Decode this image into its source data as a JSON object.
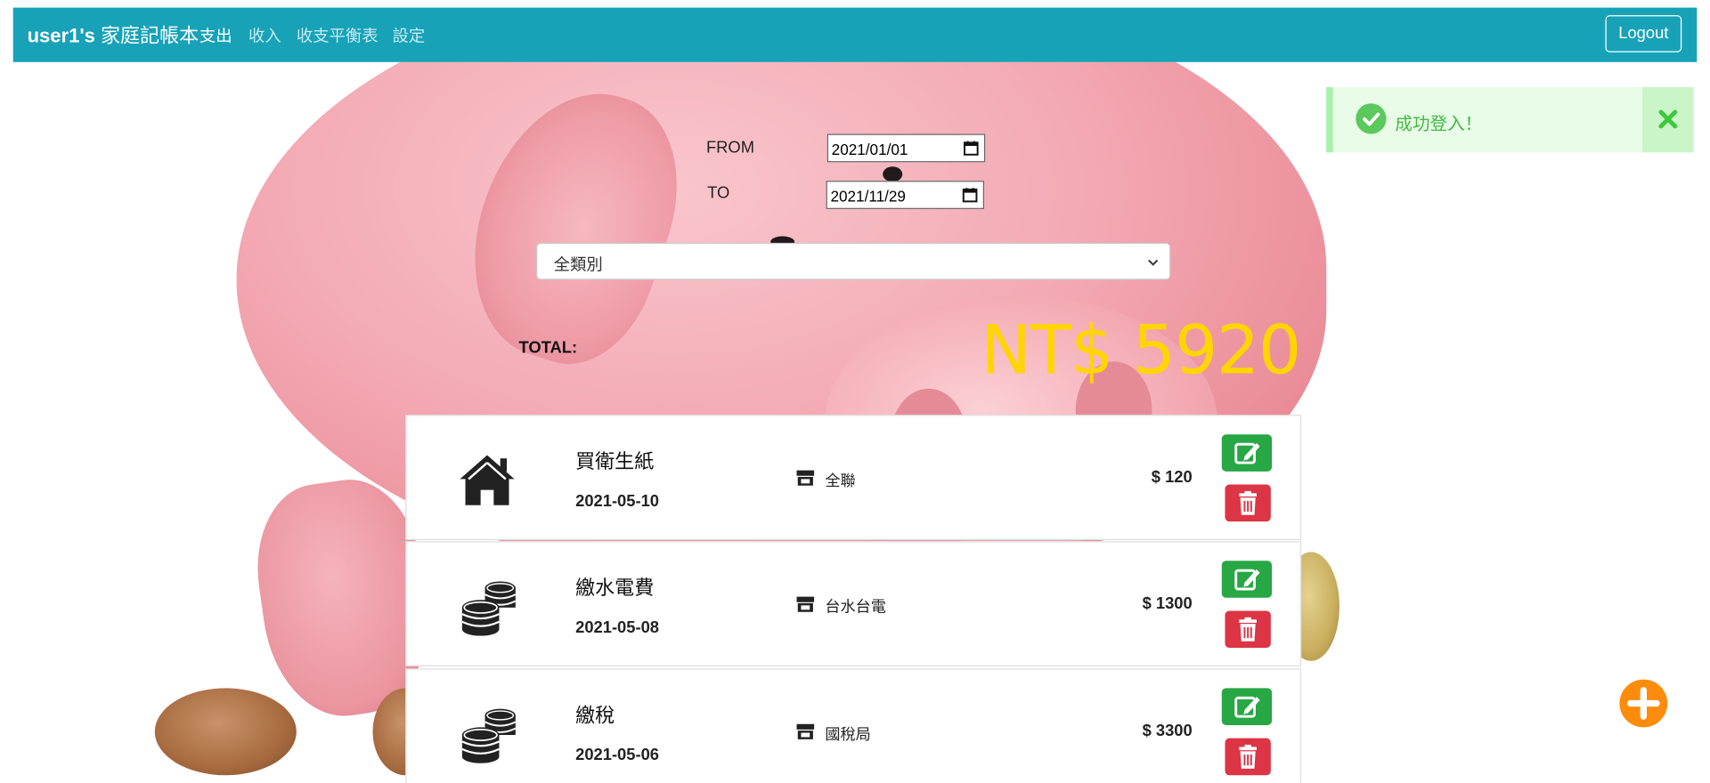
{
  "navbar": {
    "brand_user": "user1's",
    "brand_title": "家庭記帳本",
    "links": [
      "支出",
      "收入",
      "收支平衡表",
      "設定"
    ],
    "logout_label": "Logout",
    "color": "#17a2b8"
  },
  "alert": {
    "message": "成功登入！"
  },
  "filter": {
    "from_label": "FROM",
    "from_value": "2021/01/01",
    "to_label": "TO",
    "to_value": "2021/11/29",
    "category_selected": "全類別"
  },
  "total": {
    "label": "TOTAL:",
    "value": "NT$ 5920"
  },
  "records": [
    {
      "icon": "home-icon",
      "title": "買衛生紙",
      "date": "2021-05-10",
      "shop": "全聯",
      "amount": "$ 120"
    },
    {
      "icon": "coins-icon",
      "title": "繳水電費",
      "date": "2021-05-08",
      "shop": "台水台電",
      "amount": "$ 1300"
    },
    {
      "icon": "coins-icon",
      "title": "繳稅",
      "date": "2021-05-06",
      "shop": "國稅局",
      "amount": "$ 3300"
    }
  ],
  "colors": {
    "accent": "#17a2b8",
    "edit": "#28a745",
    "delete": "#dc3545",
    "fab": "#fd8c0d",
    "total": "#ffd500"
  }
}
